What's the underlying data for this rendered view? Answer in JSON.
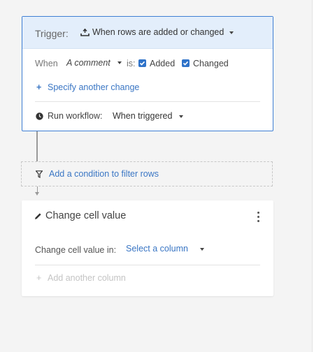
{
  "trigger": {
    "label": "Trigger:",
    "value": "When rows are added or changed",
    "icon": "row-add-icon",
    "when_label": "When",
    "column_value": "A comment",
    "is_label": "is:",
    "added": {
      "label": "Added",
      "checked": true
    },
    "changed": {
      "label": "Changed",
      "checked": true
    },
    "specify_plus": "+",
    "specify_label": "Specify another change",
    "run_label": "Run workflow:",
    "run_value": "When triggered"
  },
  "filter": {
    "icon": "filter-icon",
    "label": "Add a condition to filter rows"
  },
  "action": {
    "icon": "pencil-icon",
    "title": "Change cell value",
    "change_in_label": "Change cell value in:",
    "select_placeholder": "Select a column",
    "add_plus": "+",
    "add_label": "Add another column"
  },
  "colors": {
    "accent": "#3a76c4",
    "header_bg": "#e3eefb",
    "card_border": "#3f7fd4",
    "checkbox": "#2f73c9"
  }
}
